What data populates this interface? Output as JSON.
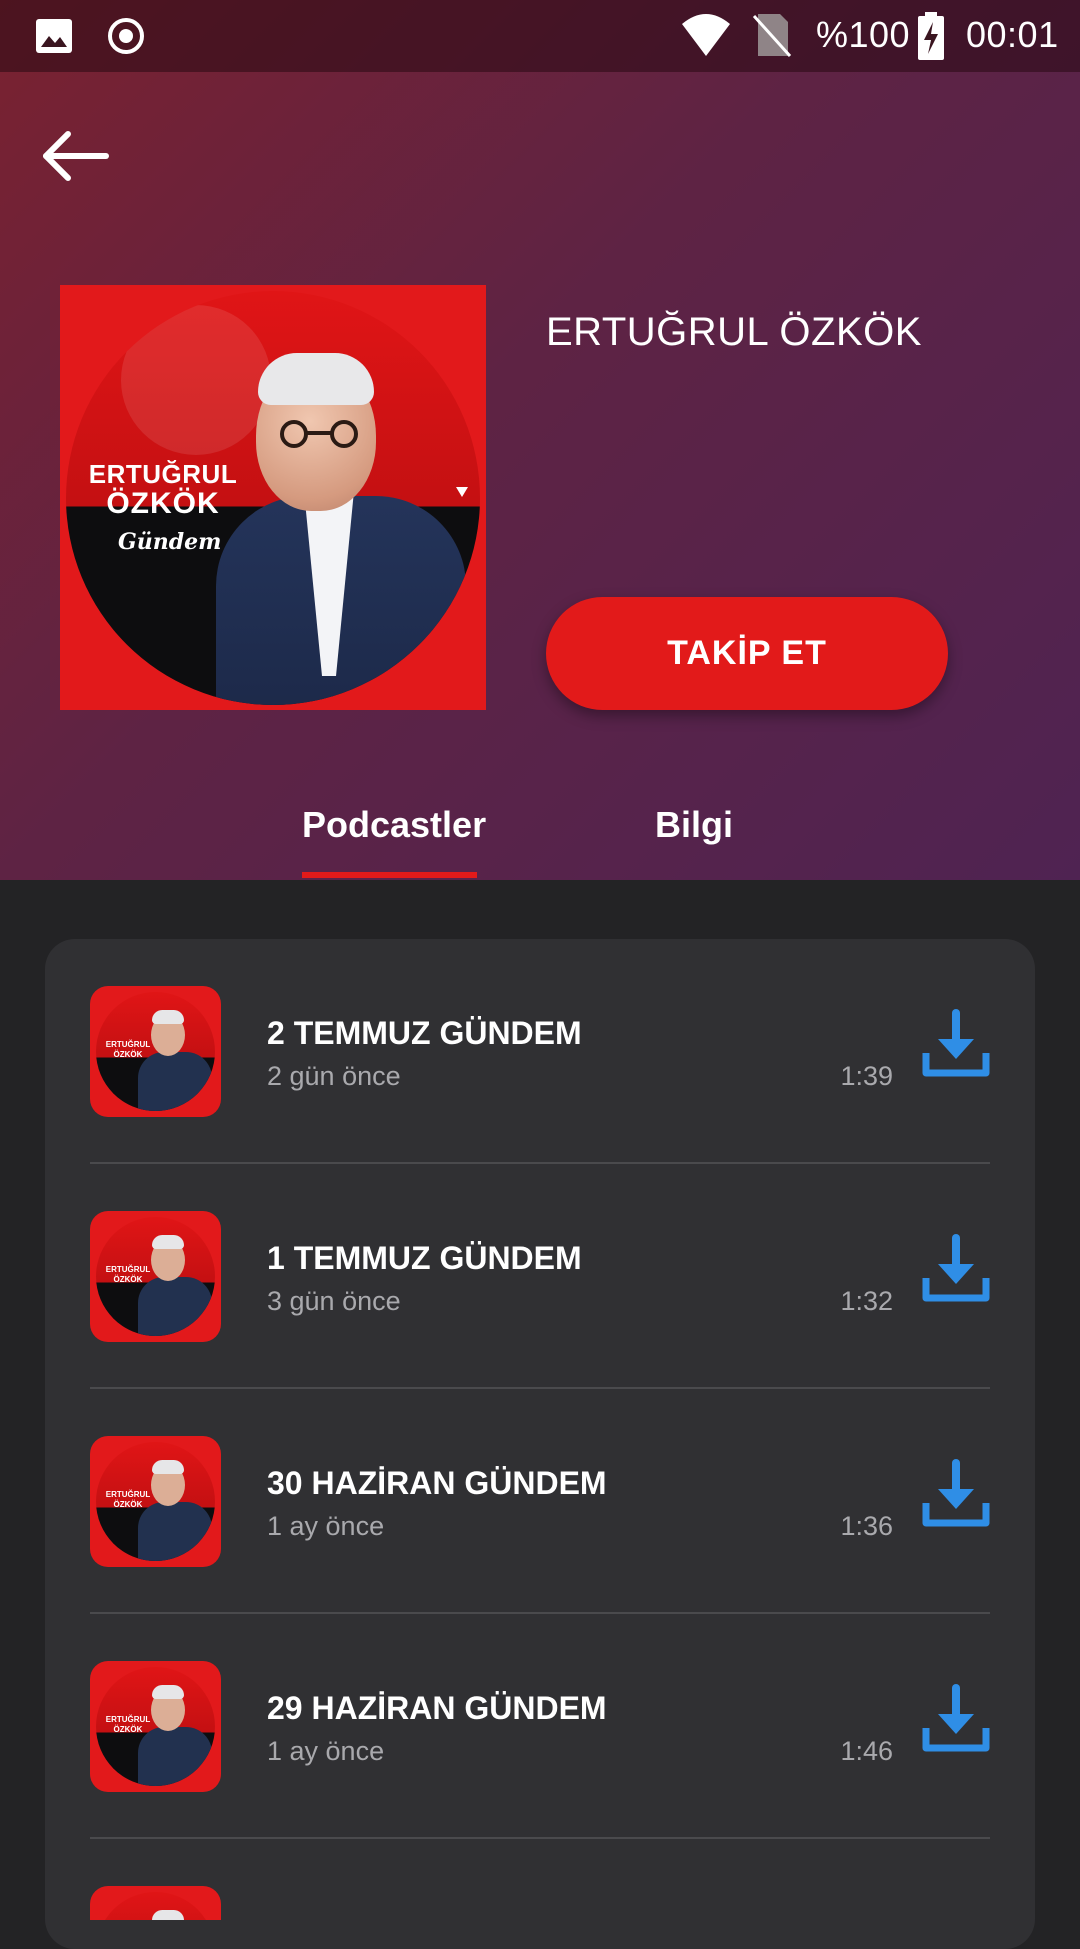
{
  "status_bar": {
    "battery": "%100",
    "time": "00:01",
    "icons": [
      "gallery-icon",
      "record-icon",
      "wifi-icon",
      "no-sim-icon",
      "battery-charging-icon"
    ]
  },
  "header": {
    "back_icon": "arrow-left-icon",
    "podcast_title": "ERTUĞRUL ÖZKÖK",
    "follow_label": "TAKİP ET",
    "cover": {
      "title_line1": "ERTUĞRUL",
      "title_line2": "ÖZKÖK",
      "subtitle": "Gündem"
    }
  },
  "tabs": [
    {
      "label": "Podcastler",
      "selected": true
    },
    {
      "label": "Bilgi",
      "selected": false
    }
  ],
  "episodes": [
    {
      "title": "2 TEMMUZ GÜNDEM",
      "date": "2 gün önce",
      "duration": "1:39"
    },
    {
      "title": "1 TEMMUZ GÜNDEM",
      "date": "3 gün önce",
      "duration": "1:32"
    },
    {
      "title": "30 HAZİRAN GÜNDEM",
      "date": "1 ay önce",
      "duration": "1:36"
    },
    {
      "title": "29 HAZİRAN GÜNDEM",
      "date": "1 ay önce",
      "duration": "1:46"
    },
    {
      "title": "",
      "date": "",
      "duration": ""
    }
  ],
  "thumb_text": {
    "line1": "ERTUĞRUL",
    "line2": "ÖZKÖK"
  },
  "colors": {
    "accent": "#e21a1a",
    "download": "#2f8ee6",
    "background": "#232325",
    "card": "#303033"
  }
}
